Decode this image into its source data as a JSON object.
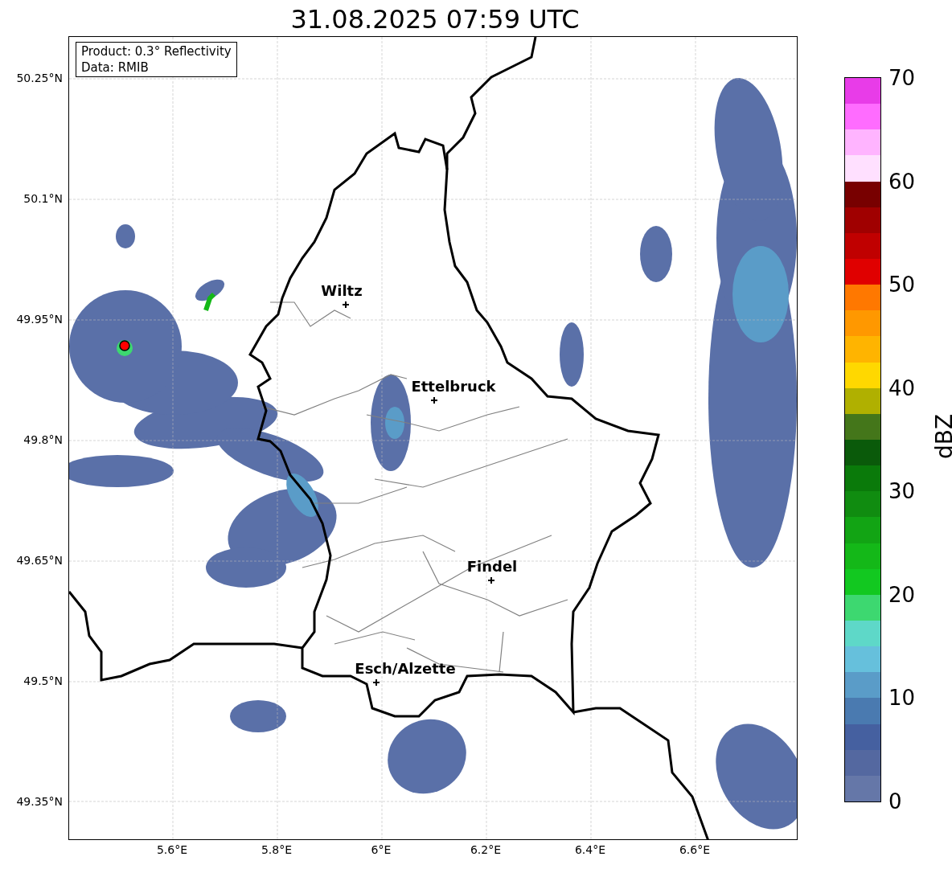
{
  "title": "31.08.2025 07:59 UTC",
  "info_box": [
    "Product: 0.3° Reflectivity",
    "Data: RMIB"
  ],
  "y_ticks": [
    "50.25°N",
    "50.1°N",
    "49.95°N",
    "49.8°N",
    "49.65°N",
    "49.5°N",
    "49.35°N"
  ],
  "x_ticks": [
    "5.6°E",
    "5.8°E",
    "6°E",
    "6.2°E",
    "6.4°E",
    "6.6°E"
  ],
  "cities": [
    {
      "name": "Wiltz"
    },
    {
      "name": "Ettelbruck"
    },
    {
      "name": "Findel"
    },
    {
      "name": "Esch/Alzette"
    }
  ],
  "colorbar": {
    "label": "dBZ",
    "ticks": [
      "70",
      "60",
      "50",
      "40",
      "30",
      "20",
      "10",
      "0"
    ],
    "bins": [
      {
        "color": "#e83ce8"
      },
      {
        "color": "#ff6cff"
      },
      {
        "color": "#ffb4ff"
      },
      {
        "color": "#ffe0ff"
      },
      {
        "color": "#780000"
      },
      {
        "color": "#a00000"
      },
      {
        "color": "#c00000"
      },
      {
        "color": "#e00000"
      },
      {
        "color": "#ff7800"
      },
      {
        "color": "#ff9800"
      },
      {
        "color": "#ffb400"
      },
      {
        "color": "#ffd800"
      },
      {
        "color": "#b0b000"
      },
      {
        "color": "#44761a"
      },
      {
        "color": "#0a5a0a"
      },
      {
        "color": "#0a7a0a"
      },
      {
        "color": "#108c10"
      },
      {
        "color": "#12a414"
      },
      {
        "color": "#14b818"
      },
      {
        "color": "#12c820"
      },
      {
        "color": "#3dd870"
      },
      {
        "color": "#5ed8c8"
      },
      {
        "color": "#66c0dc"
      },
      {
        "color": "#5a9cc8"
      },
      {
        "color": "#4a7ab0"
      },
      {
        "color": "#4560a0"
      },
      {
        "color": "#5468a0"
      },
      {
        "color": "#6577a8"
      }
    ]
  }
}
